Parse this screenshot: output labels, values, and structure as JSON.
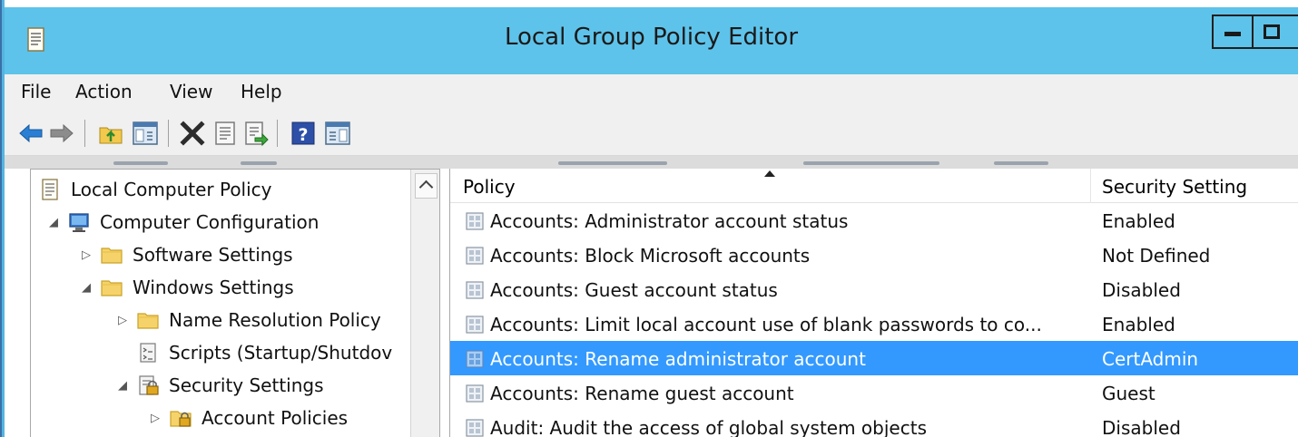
{
  "window": {
    "title": "Local Group Policy Editor"
  },
  "menu": {
    "items": [
      {
        "label": "File"
      },
      {
        "label": "Action"
      },
      {
        "label": "View"
      },
      {
        "label": "Help"
      }
    ]
  },
  "toolbar": {
    "buttons": [
      {
        "icon": "back-arrow-icon"
      },
      {
        "icon": "forward-arrow-icon"
      },
      {
        "icon": "up-folder-icon"
      },
      {
        "icon": "show-hide-console-tree-icon"
      },
      {
        "icon": "delete-icon"
      },
      {
        "icon": "properties-icon"
      },
      {
        "icon": "export-list-icon"
      },
      {
        "icon": "help-icon"
      },
      {
        "icon": "show-hide-action-pane-icon"
      }
    ]
  },
  "tree": {
    "items": [
      {
        "label": "Local Computer Policy",
        "icon": "policy-document-icon",
        "expander": ""
      },
      {
        "label": "Computer Configuration",
        "icon": "computer-icon",
        "expander": "◢"
      },
      {
        "label": "Software Settings",
        "icon": "folder-icon",
        "expander": "▷"
      },
      {
        "label": "Windows Settings",
        "icon": "folder-icon",
        "expander": "◢"
      },
      {
        "label": "Name Resolution Policy",
        "icon": "folder-icon",
        "expander": "▷"
      },
      {
        "label": "Scripts (Startup/Shutdov",
        "icon": "script-icon",
        "expander": ""
      },
      {
        "label": "Security Settings",
        "icon": "security-settings-icon",
        "expander": "◢"
      },
      {
        "label": "Account Policies",
        "icon": "lock-folder-icon",
        "expander": "▷"
      }
    ]
  },
  "list": {
    "columns": {
      "policy": "Policy",
      "setting": "Security Setting"
    },
    "rows": [
      {
        "policy": "Accounts: Administrator account status",
        "setting": "Enabled",
        "selected": false
      },
      {
        "policy": "Accounts: Block Microsoft accounts",
        "setting": "Not Defined",
        "selected": false
      },
      {
        "policy": "Accounts: Guest account status",
        "setting": "Disabled",
        "selected": false
      },
      {
        "policy": "Accounts: Limit local account use of blank passwords to co...",
        "setting": "Enabled",
        "selected": false
      },
      {
        "policy": "Accounts: Rename administrator account",
        "setting": "CertAdmin",
        "selected": true
      },
      {
        "policy": "Accounts: Rename guest account",
        "setting": "Guest",
        "selected": false
      },
      {
        "policy": "Audit: Audit the access of global system objects",
        "setting": "Disabled",
        "selected": false
      }
    ]
  },
  "colors": {
    "titlebar": "#5ec3ea",
    "selection": "#3399ff",
    "chrome": "#f0f0f0"
  }
}
